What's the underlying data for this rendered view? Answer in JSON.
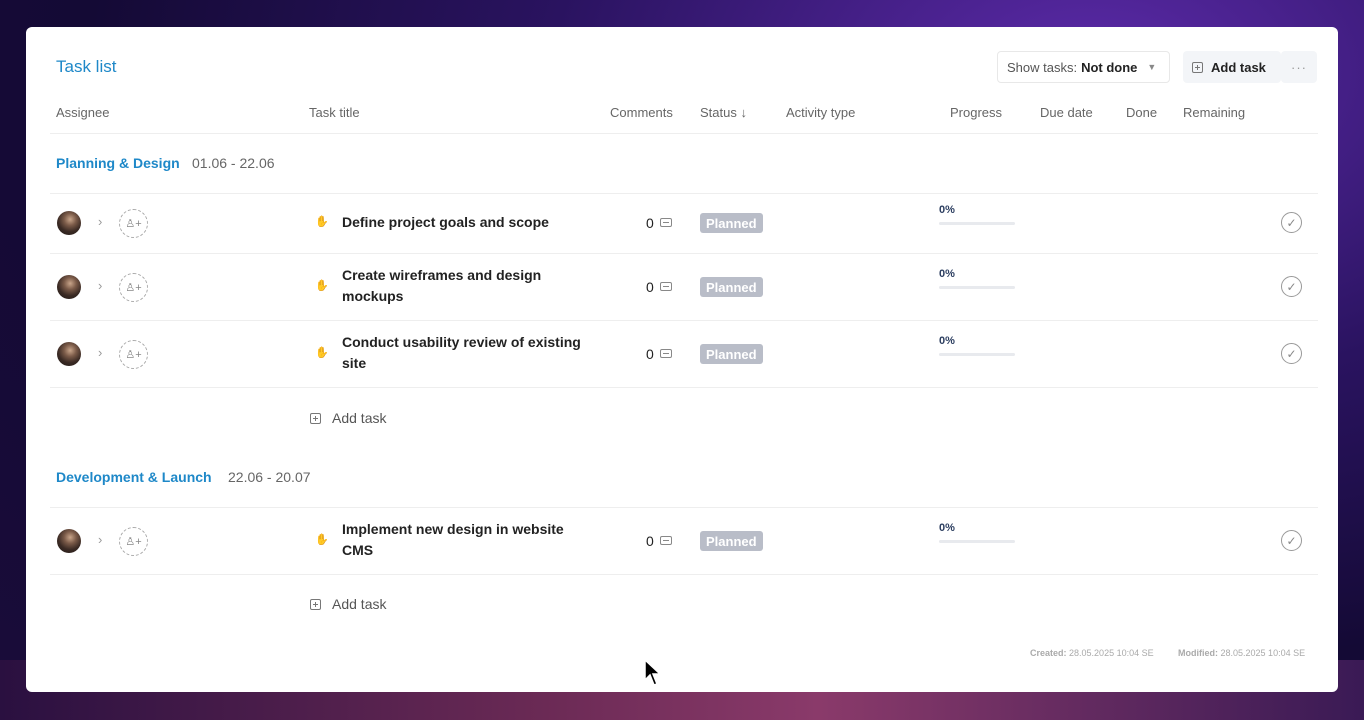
{
  "header": {
    "title": "Task list",
    "show_tasks_label": "Show tasks:",
    "show_tasks_value": "Not done",
    "add_task_label": "Add task",
    "more_label": "···"
  },
  "columns": [
    "Assignee",
    "Task title",
    "Comments",
    "Status ↓",
    "Activity type",
    "Progress",
    "Due date",
    "Done",
    "Remaining"
  ],
  "groups": [
    {
      "name": "Planning & Design",
      "dates": "01.06 - 22.06",
      "tasks": [
        {
          "title": "Define project goals and scope",
          "comments": "0",
          "status": "Planned",
          "progress_label": "0%",
          "progress": 0
        },
        {
          "title": "Create wireframes and design mockups",
          "comments": "0",
          "status": "Planned",
          "progress_label": "0%",
          "progress": 0
        },
        {
          "title": "Conduct usability review of existing site",
          "comments": "0",
          "status": "Planned",
          "progress_label": "0%",
          "progress": 0
        }
      ],
      "add_task_label": "Add task"
    },
    {
      "name": "Development & Launch",
      "dates": "22.06 - 20.07",
      "tasks": [
        {
          "title": "Implement new design in website CMS",
          "comments": "0",
          "status": "Planned",
          "progress_label": "0%",
          "progress": 0
        }
      ],
      "add_task_label": "Add task"
    }
  ],
  "footer": {
    "created_label": "Created:",
    "created_value": "28.05.2025 10:04 SE",
    "modified_label": "Modified:",
    "modified_value": "28.05.2025 10:04 SE"
  },
  "colors": {
    "accent": "#1e88c8",
    "status_planned": "#b9bdc8",
    "progress_fill": "#2a8bd0"
  },
  "icons": {
    "task_type": "handshake-icon",
    "comment": "comment-icon",
    "add_user": "add-user-icon",
    "done": "check-circle-icon",
    "expand": "chevron-right-icon"
  }
}
